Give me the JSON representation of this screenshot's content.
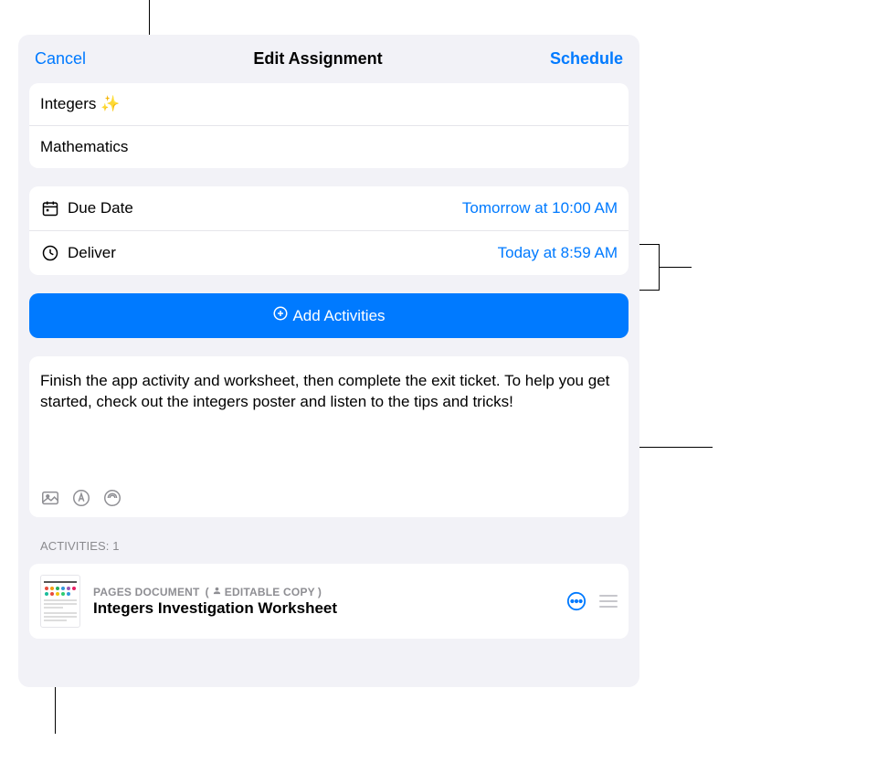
{
  "header": {
    "cancel": "Cancel",
    "title": "Edit Assignment",
    "schedule": "Schedule"
  },
  "assignment": {
    "title": "Integers ✨",
    "subject": "Mathematics"
  },
  "dates": {
    "due_label": "Due Date",
    "due_value": "Tomorrow at 10:00 AM",
    "deliver_label": "Deliver",
    "deliver_value": "Today at 8:59 AM"
  },
  "add_activities_label": "Add Activities",
  "instructions": "Finish the app activity and worksheet, then complete the exit ticket. To help you get started, check out the integers poster and listen to the tips and tricks!",
  "activities": {
    "header": "ACTIVITIES: 1",
    "items": [
      {
        "type_label": "PAGES DOCUMENT",
        "badge_label": "EDITABLE COPY",
        "title": "Integers Investigation Worksheet"
      }
    ]
  },
  "icons": {
    "calendar": "calendar-icon",
    "clock": "clock-icon",
    "plus_circle": "plus-circle-icon",
    "photo": "photo-icon",
    "markup": "markup-icon",
    "audio": "audio-icon",
    "person": "person-icon",
    "more": "more-icon",
    "reorder": "reorder-icon"
  }
}
